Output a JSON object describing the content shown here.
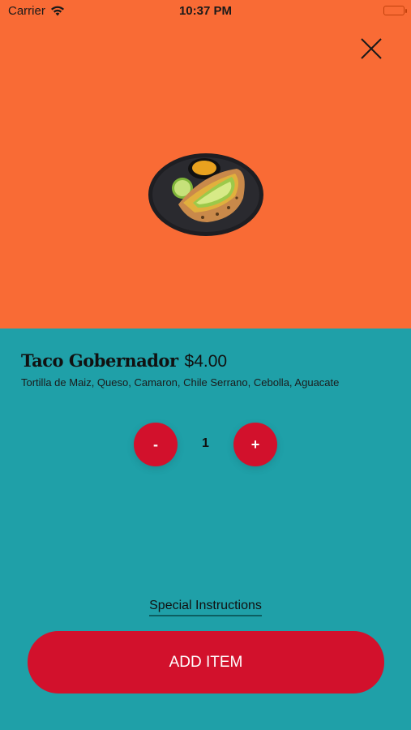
{
  "status_bar": {
    "carrier": "Carrier",
    "time": "10:37 PM"
  },
  "colors": {
    "header_bg": "#f96b35",
    "body_bg": "#1fa0a8",
    "accent": "#d2112c"
  },
  "icons": {
    "close": "close-icon",
    "wifi": "wifi-icon",
    "battery": "battery-icon"
  },
  "item": {
    "name": "Taco Gobernador",
    "price": "$4.00",
    "description": "Tortilla de Maiz, Queso, Camaron, Chile Serrano, Cebolla, Aguacate"
  },
  "quantity": {
    "minus_label": "-",
    "value": "1",
    "plus_label": "+"
  },
  "special_instructions_label": "Special Instructions",
  "add_button_label": "ADD ITEM"
}
